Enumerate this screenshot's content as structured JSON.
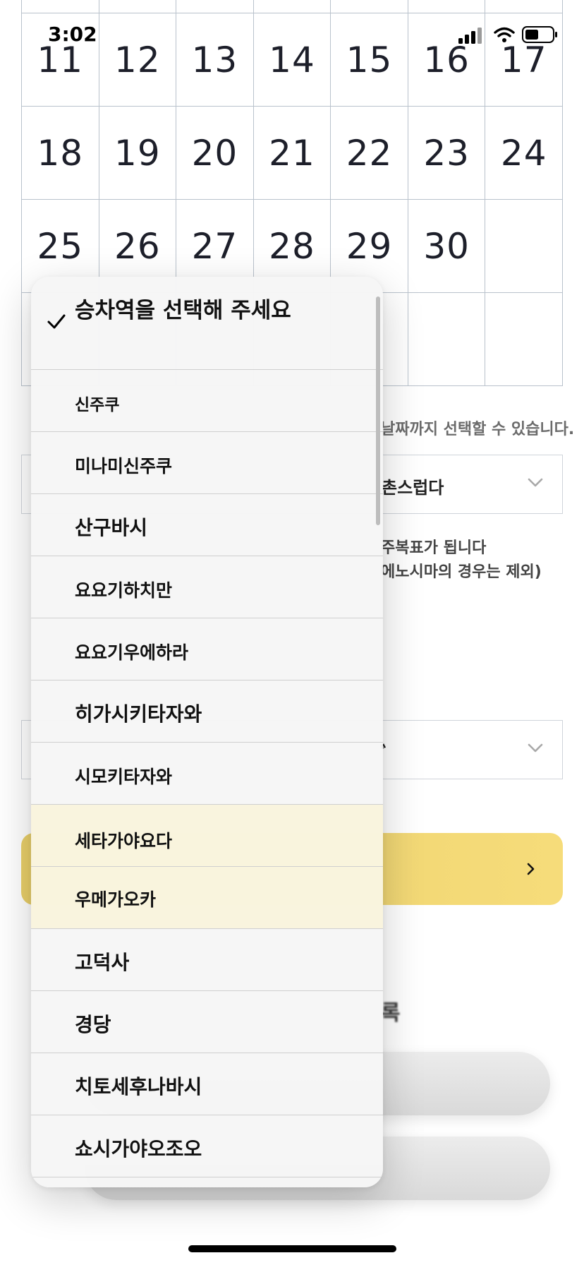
{
  "status_bar": {
    "time": "3:02"
  },
  "calendar": {
    "top_row": [
      "",
      "",
      "",
      "",
      "",
      "",
      ""
    ],
    "rows": [
      [
        "11",
        "12",
        "13",
        "14",
        "15",
        "16",
        "17"
      ],
      [
        "18",
        "19",
        "20",
        "21",
        "22",
        "23",
        "24"
      ],
      [
        "25",
        "26",
        "27",
        "28",
        "29",
        "30",
        ""
      ],
      [
        "",
        "",
        "",
        "",
        "",
        "",
        ""
      ]
    ]
  },
  "background": {
    "date_note": "날짜까지 선택할 수 있습니다.",
    "select1_text": "촌스럽다",
    "info_line1": "주복표가 됩니다",
    "info_line2": "에노시마의 경우는 제외)",
    "select2_text": "ﾞ",
    "partial_label": "록"
  },
  "picker": {
    "header": "승차역을 선택해 주세요",
    "items": [
      "신주쿠",
      "미나미신주쿠",
      "산구바시",
      "요요기하치만",
      "요요기우에하라",
      "히가시키타자와",
      "시모키타자와",
      "세타가야요다",
      "우메가오카",
      "고덕사",
      "경당",
      "치토세후나바시",
      "쇼시가야오조오"
    ]
  }
}
